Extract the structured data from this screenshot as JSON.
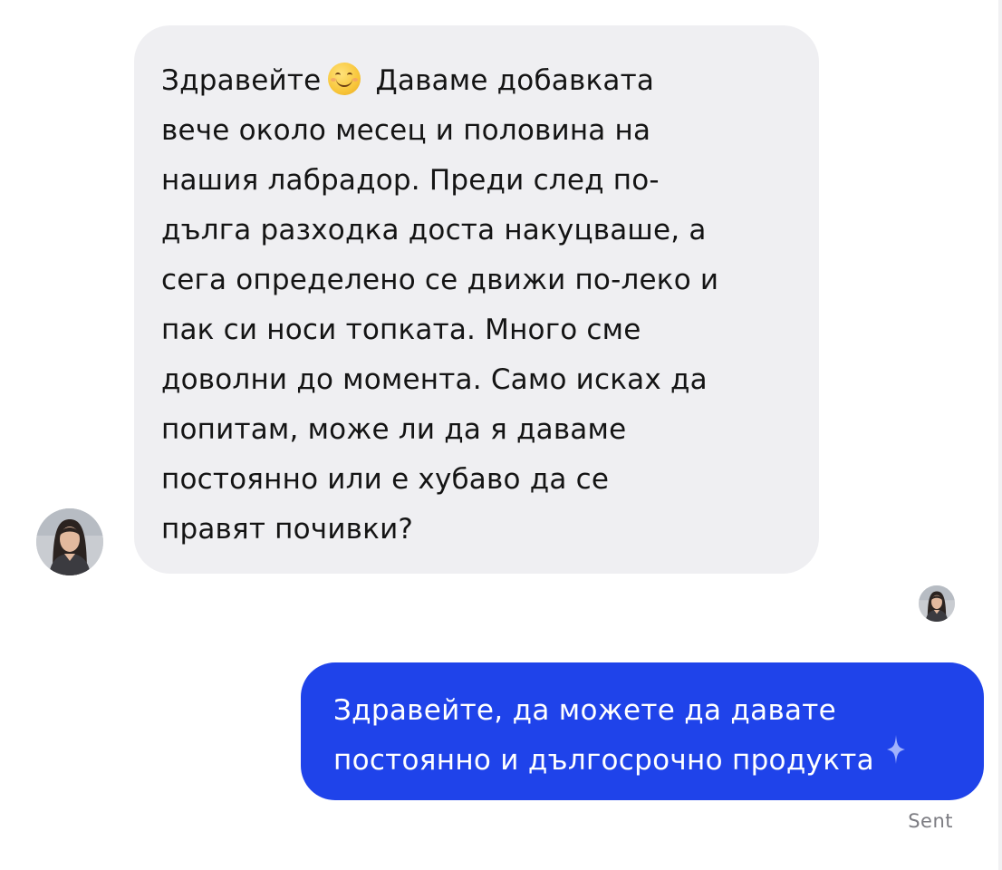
{
  "conversation": {
    "incoming": {
      "lines": [
        "Здравейте",
        "Даваме добавката",
        "вече около месец и половина на",
        "нашия лабрадор. Преди след по-",
        "дълга разходка доста накуцваше, а",
        "сега определено се движи по-леко и",
        "пак си носи топката. Много сме",
        "доволни до момента. Само исках да",
        "попитам, може ли да я даваме",
        "постоянно или е хубаво да се",
        "правят почивки?"
      ],
      "emoji": "smiling-face-emoji"
    },
    "outgoing": {
      "lines": [
        "Здравейте, да можете да давате",
        "постоянно и дългосрочно продукта"
      ],
      "status": "Sent"
    }
  },
  "colors": {
    "incoming_bubble": "#efeff2",
    "outgoing_bubble": "#1f43ea",
    "status_text": "#7c7c82"
  }
}
